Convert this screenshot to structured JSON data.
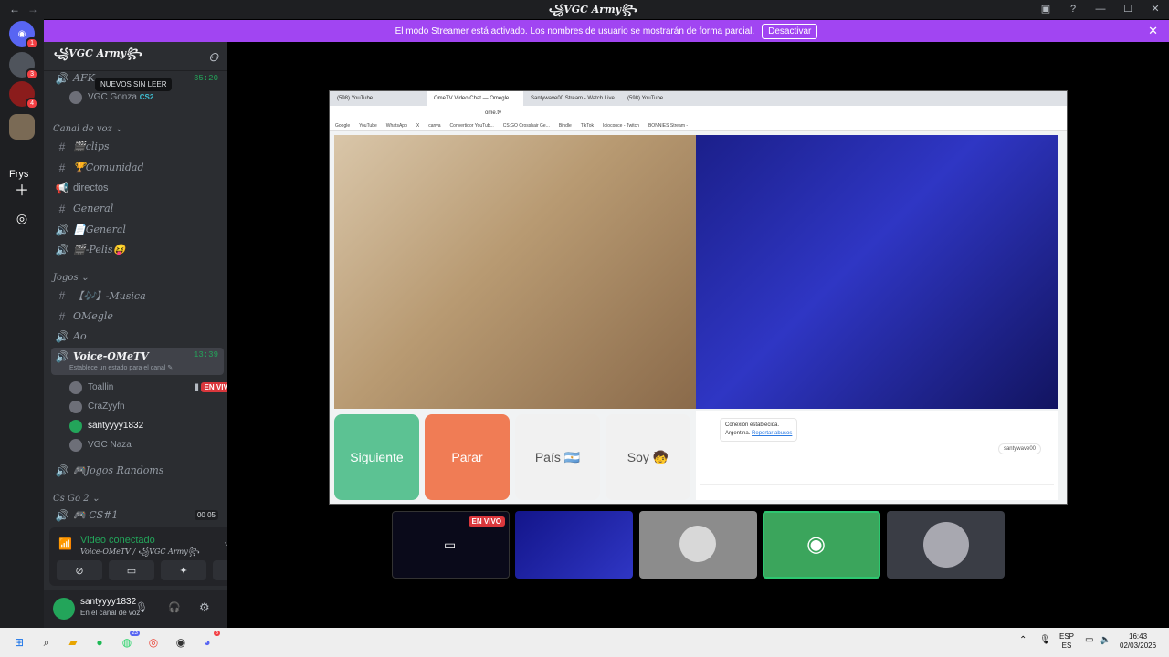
{
  "window": {
    "title": "꧁VGC Army꧂",
    "back_icon": "←",
    "forward_icon": "→"
  },
  "streamer_mode": {
    "text": "El modo Streamer está activado. Los nombres de usuario se mostrarán de forma parcial.",
    "button": "Desactivar"
  },
  "guilds": [
    {
      "badge": "1"
    },
    {
      "badge": "3"
    },
    {
      "badge": "4"
    },
    {
      "badge": ""
    }
  ],
  "guild_label": "Frys",
  "server": {
    "name": "꧁VGC Army꧂"
  },
  "tooltip": "NUEVOS SIN LEER",
  "channels": {
    "afk": {
      "name": "AFK",
      "time": "35:20"
    },
    "afk_member": {
      "name": "VGC Gonza",
      "tag": "CS2"
    },
    "cat_voz": "Canal de voz ⌄",
    "clips": "🎬clips",
    "comunidad": "🏆Comunidad",
    "directos": "directos",
    "general_text": "General",
    "general_voice": "📄General",
    "pelis": "🎬-Pelis😝",
    "cat_jogos": "Jogos ⌄",
    "musica": "【🎶】-Musica",
    "omegle": "OMegle",
    "ao": "Ao",
    "voice_ometv": {
      "name": "Voice-OMeTV",
      "time": "13:39",
      "status": "Establece un estado para el canal ✎"
    },
    "members": [
      "Toallin",
      "CraZyyfn",
      "santyyyy1832",
      "VGC Naza"
    ],
    "live": "EN VIVO",
    "randoms": "🎮Jogos Randoms",
    "cat_csgo": "Cs Go 2 ⌄",
    "cs1": {
      "name": "🎮 CS#1",
      "count_a": "00",
      "count_b": "05"
    }
  },
  "voice_panel": {
    "status": "Video conectado",
    "channel": "Voice-OMeTV / ꧁VGC Army꧂"
  },
  "user_panel": {
    "name": "santyyyy1832",
    "status": "En el canal de voz"
  },
  "browser": {
    "tabs": [
      "(598) YouTube",
      "OmeTV Video Chat — Omegle",
      "Santywave00 Stream - Watch Live",
      "(598) YouTube"
    ],
    "url": "ome.tv",
    "bookmarks": [
      "Google",
      "YouTube",
      "WhatsApp",
      "X",
      "canva",
      "Convertidor YouTub...",
      "CS:GO Crosshair Ge...",
      "Bindle",
      "TikTok",
      "Idioconce - Twitch",
      "BONNIES Stream -"
    ],
    "buttons": {
      "next": "Siguiente",
      "stop": "Parar",
      "country": "País 🇦🇷",
      "gender": "Soy 🧒"
    },
    "chat": {
      "line1": "Conexión establecida.",
      "line2": "Argentina.",
      "report": "Reportar abusos",
      "self": "santywave00"
    }
  },
  "thumb_live": "EN VIVO",
  "taskbar": {
    "lang_top": "ESP",
    "lang_bottom": "ES",
    "time": "16:43",
    "date": "02/03/2026",
    "badge_whatsapp": "23",
    "badge_discord": "8"
  }
}
